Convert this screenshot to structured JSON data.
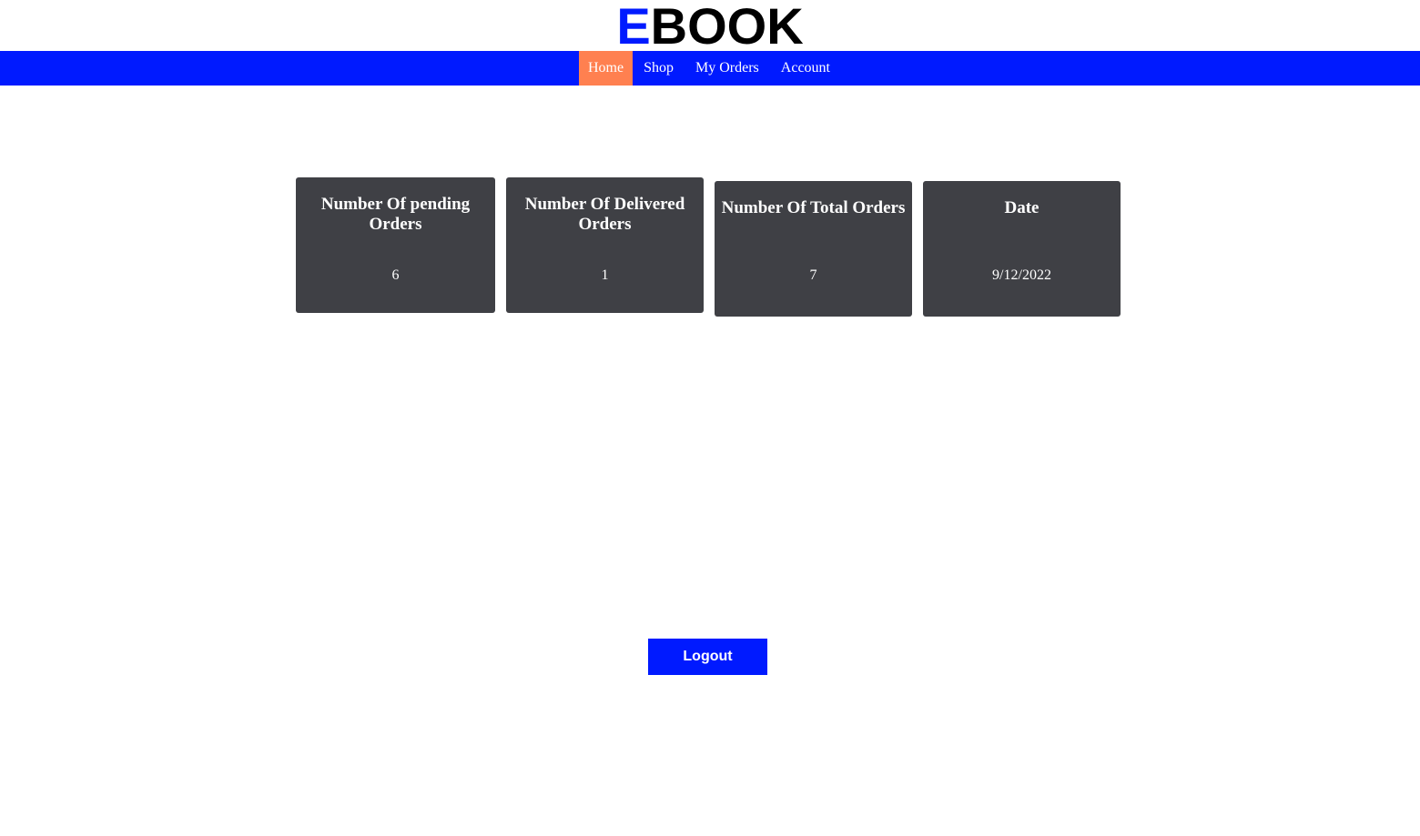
{
  "logo": {
    "first_letter": "E",
    "rest": "BOOK"
  },
  "nav": {
    "items": [
      {
        "label": "Home",
        "active": true
      },
      {
        "label": "Shop",
        "active": false
      },
      {
        "label": "My Orders",
        "active": false
      },
      {
        "label": "Account",
        "active": false
      }
    ]
  },
  "cards": [
    {
      "title": "Number Of pending Orders",
      "value": "6"
    },
    {
      "title": "Number Of Delivered Orders",
      "value": "1"
    },
    {
      "title": "Number Of Total Orders",
      "value": "7"
    },
    {
      "title": "Date",
      "value": "9/12/2022"
    }
  ],
  "logout": {
    "label": "Logout"
  },
  "colors": {
    "brand_blue": "#001aff",
    "active_nav": "#ff8050",
    "card_bg": "#3f4045"
  }
}
